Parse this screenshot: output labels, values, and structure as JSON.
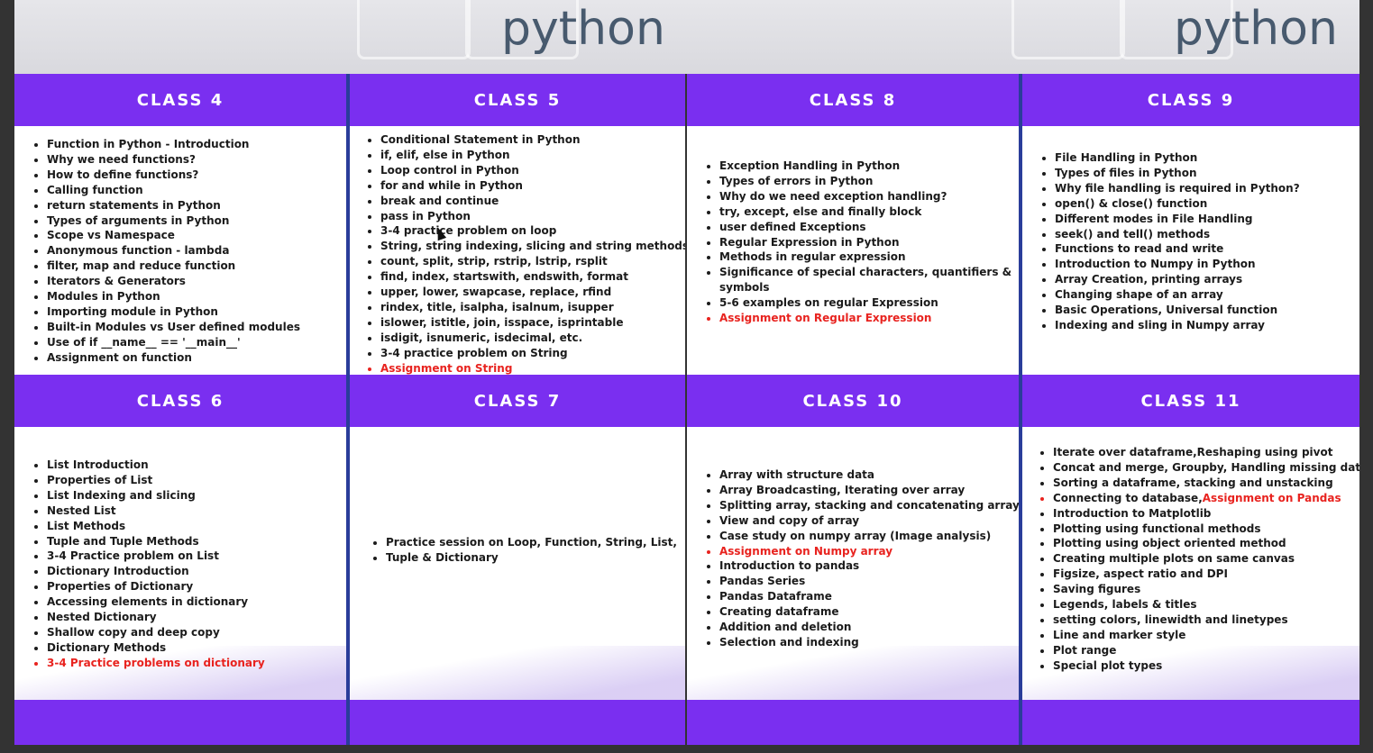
{
  "banner": {
    "logo_left": "python",
    "logo_right": "python"
  },
  "classes": {
    "c4": {
      "title": "CLASS 4",
      "items": [
        "Function in Python - Introduction",
        "Why we need functions?",
        "How to define functions?",
        "Calling function",
        "return statements in Python",
        "Types of arguments in Python",
        "Scope vs Namespace",
        "Anonymous function - lambda",
        "filter, map and reduce function",
        "Iterators & Generators",
        "Modules in Python",
        "Importing module in Python",
        "Built-in Modules vs User defined modules",
        "Use of if __name__ == '__main__'",
        "Assignment on function"
      ]
    },
    "c5": {
      "title": "CLASS 5",
      "items": [
        "Conditional Statement in Python",
        "if, elif, else in Python",
        "Loop control in Python",
        "for and while in Python",
        "break and continue",
        "pass in Python",
        "3-4 practice problem on loop",
        "String, string indexing, slicing and string methods",
        "count, split, strip, rstrip, lstrip, rsplit",
        "find, index, startswith, endswith, format",
        "upper, lower, swapcase, replace, rfind",
        "rindex, title, isalpha, isalnum, isupper",
        "islower, istitle, join, isspace, isprintable",
        "isdigit, isnumeric, isdecimal, etc.",
        "3-4 practice problem on String",
        "Assignment on String"
      ]
    },
    "c8": {
      "title": "CLASS 8",
      "items": [
        "Exception Handling in Python",
        "Types of errors in Python",
        "Why do we need exception handling?",
        "try, except, else and finally block",
        "user defined Exceptions",
        "Regular Expression in Python",
        "Methods in regular expression",
        "Significance of special characters, quantifiers &",
        "symbols",
        "5-6 examples on regular Expression",
        "Assignment on Regular Expression"
      ]
    },
    "c9": {
      "title": "CLASS 9",
      "items": [
        "File Handling in Python",
        "Types of files in Python",
        "Why file handling is required in Python?",
        "open() & close() function",
        "Different modes in File Handling",
        "seek() and tell() methods",
        "Functions to read and write",
        "Introduction to Numpy in Python",
        "Array Creation, printing arrays",
        "Changing shape of an array",
        "Basic Operations, Universal function",
        "Indexing and sling in Numpy array"
      ]
    },
    "c6": {
      "title": "CLASS 6",
      "items": [
        "List Introduction",
        "Properties of List",
        "List Indexing and slicing",
        "Nested List",
        "List Methods",
        "Tuple and Tuple Methods",
        "3-4 Practice problem on List",
        "Dictionary Introduction",
        "Properties of Dictionary",
        "Accessing elements in dictionary",
        "Nested Dictionary",
        "Shallow copy and deep copy",
        "Dictionary Methods",
        "3-4 Practice problems on dictionary"
      ]
    },
    "c7": {
      "title": "CLASS 7",
      "items": [
        "Practice session on Loop, Function, String, List,",
        "Tuple & Dictionary"
      ]
    },
    "c10": {
      "title": "CLASS 10",
      "items": [
        "Array with structure data",
        "Array Broadcasting, Iterating over array",
        "Splitting array, stacking and concatenating array",
        "View and copy of array",
        "Case study on numpy array (Image analysis)",
        "Assignment on Numpy array",
        "Introduction to pandas",
        "Pandas Series",
        "Pandas Dataframe",
        "Creating dataframe",
        "Addition and deletion",
        "Selection and indexing"
      ]
    },
    "c11": {
      "title": "CLASS 11",
      "items": [
        "Iterate over dataframe,Reshaping using pivot",
        "Concat and merge, Groupby, Handling missing data",
        "Sorting a dataframe, stacking and unstacking",
        "Connecting to database,",
        "Introduction to Matplotlib",
        "Plotting using functional methods",
        "Plotting using object oriented method",
        "Creating multiple plots on same canvas",
        "Figsize, aspect ratio and DPI",
        "Saving figures",
        "Legends, labels & titles",
        "setting colors, linewidth and linetypes",
        "Line and marker style",
        "Plot range",
        "Special plot types"
      ],
      "inline_red": "Assignment on Pandas"
    }
  },
  "colors": {
    "header": "#7a2ff0",
    "highlight": "#e8231f",
    "divider": "#2a3d9a"
  }
}
